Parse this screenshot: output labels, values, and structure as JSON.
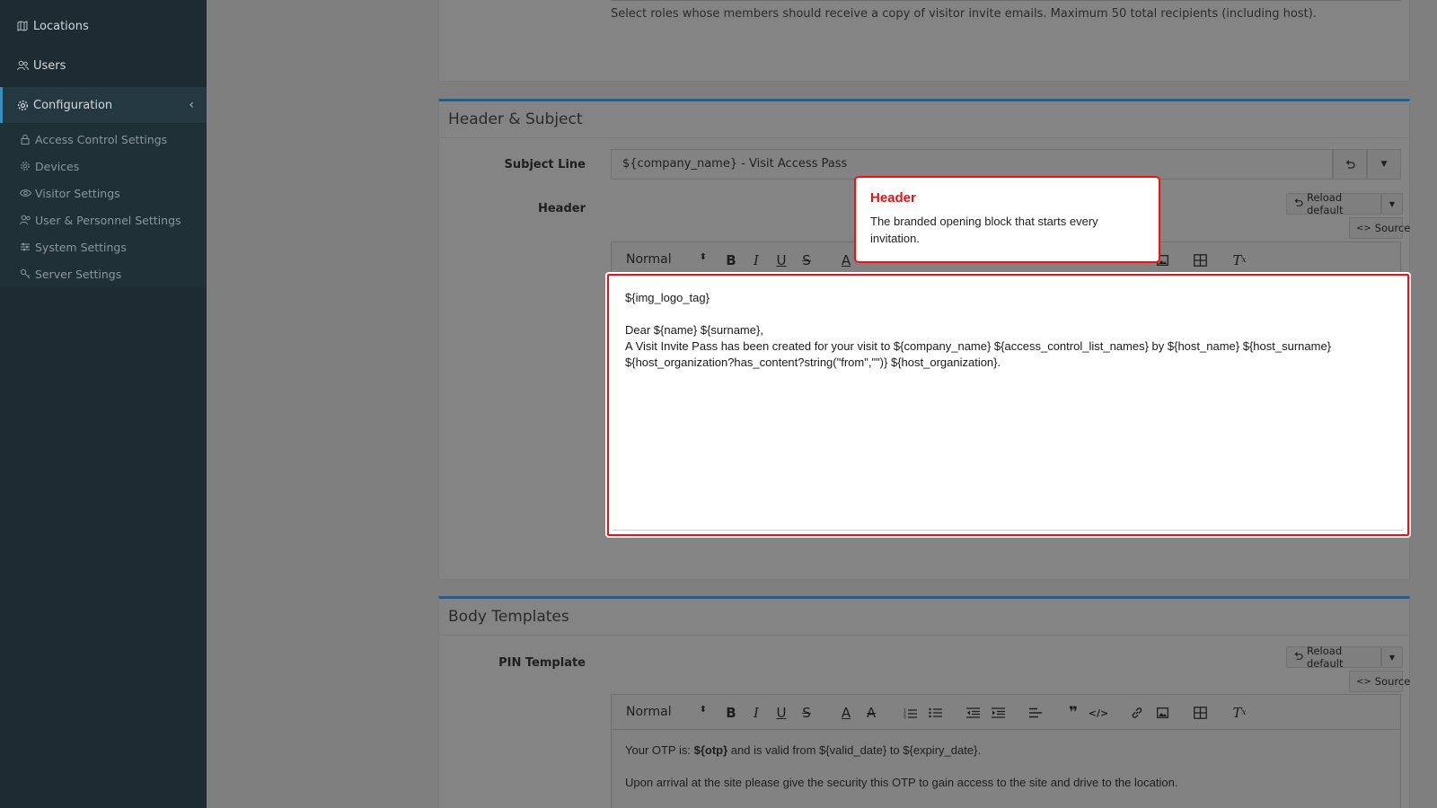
{
  "sidebar": {
    "items": [
      {
        "label": "Locations",
        "icon": "map-icon"
      },
      {
        "label": "Users",
        "icon": "users-icon"
      },
      {
        "label": "Configuration",
        "icon": "gear-icon",
        "active": true
      }
    ],
    "sub_items": [
      {
        "label": "Access Control Settings",
        "icon": "lock-icon"
      },
      {
        "label": "Devices",
        "icon": "gear-icon"
      },
      {
        "label": "Visitor Settings",
        "icon": "eye-icon"
      },
      {
        "label": "User & Personnel Settings",
        "icon": "users-icon"
      },
      {
        "label": "System Settings",
        "icon": "sliders-icon"
      },
      {
        "label": "Server Settings",
        "icon": "key-icon"
      }
    ]
  },
  "top_card": {
    "help_text": "Select roles whose members should receive a copy of visitor invite emails. Maximum 50 total recipients (including host)."
  },
  "header_subject": {
    "title": "Header & Subject",
    "subject_label": "Subject Line",
    "subject_value": "${company_name} - Visit Access Pass",
    "header_label": "Header",
    "reload_label": "Reload default",
    "source_label": "Source",
    "format_select": "Normal",
    "editor_lines": [
      "${img_logo_tag}",
      "Dear ${name} ${surname},",
      "A Visit Invite Pass has been created for your visit to ${company_name} ${access_control_list_names} by ${host_name} ${host_surname}",
      "${host_organization?has_content?string(\"from\",\"\")} ${host_organization}."
    ]
  },
  "tooltip": {
    "title": "Header",
    "text": "The branded opening block that starts every invitation."
  },
  "body_templates": {
    "title": "Body Templates",
    "pin_label": "PIN Template",
    "reload_label": "Reload default",
    "source_label": "Source",
    "format_select": "Normal",
    "line1_prefix": "Your OTP is: ",
    "line1_bold": "${otp}",
    "line1_suffix": " and is valid from ${valid_date} to ${expiry_date}.",
    "line2": "Upon arrival at the site please give the security this OTP to gain access to the site and drive to the location."
  },
  "colors": {
    "accent": "#3c8dbc",
    "highlight": "#e11111",
    "tooltip_title": "#d21a1a"
  }
}
